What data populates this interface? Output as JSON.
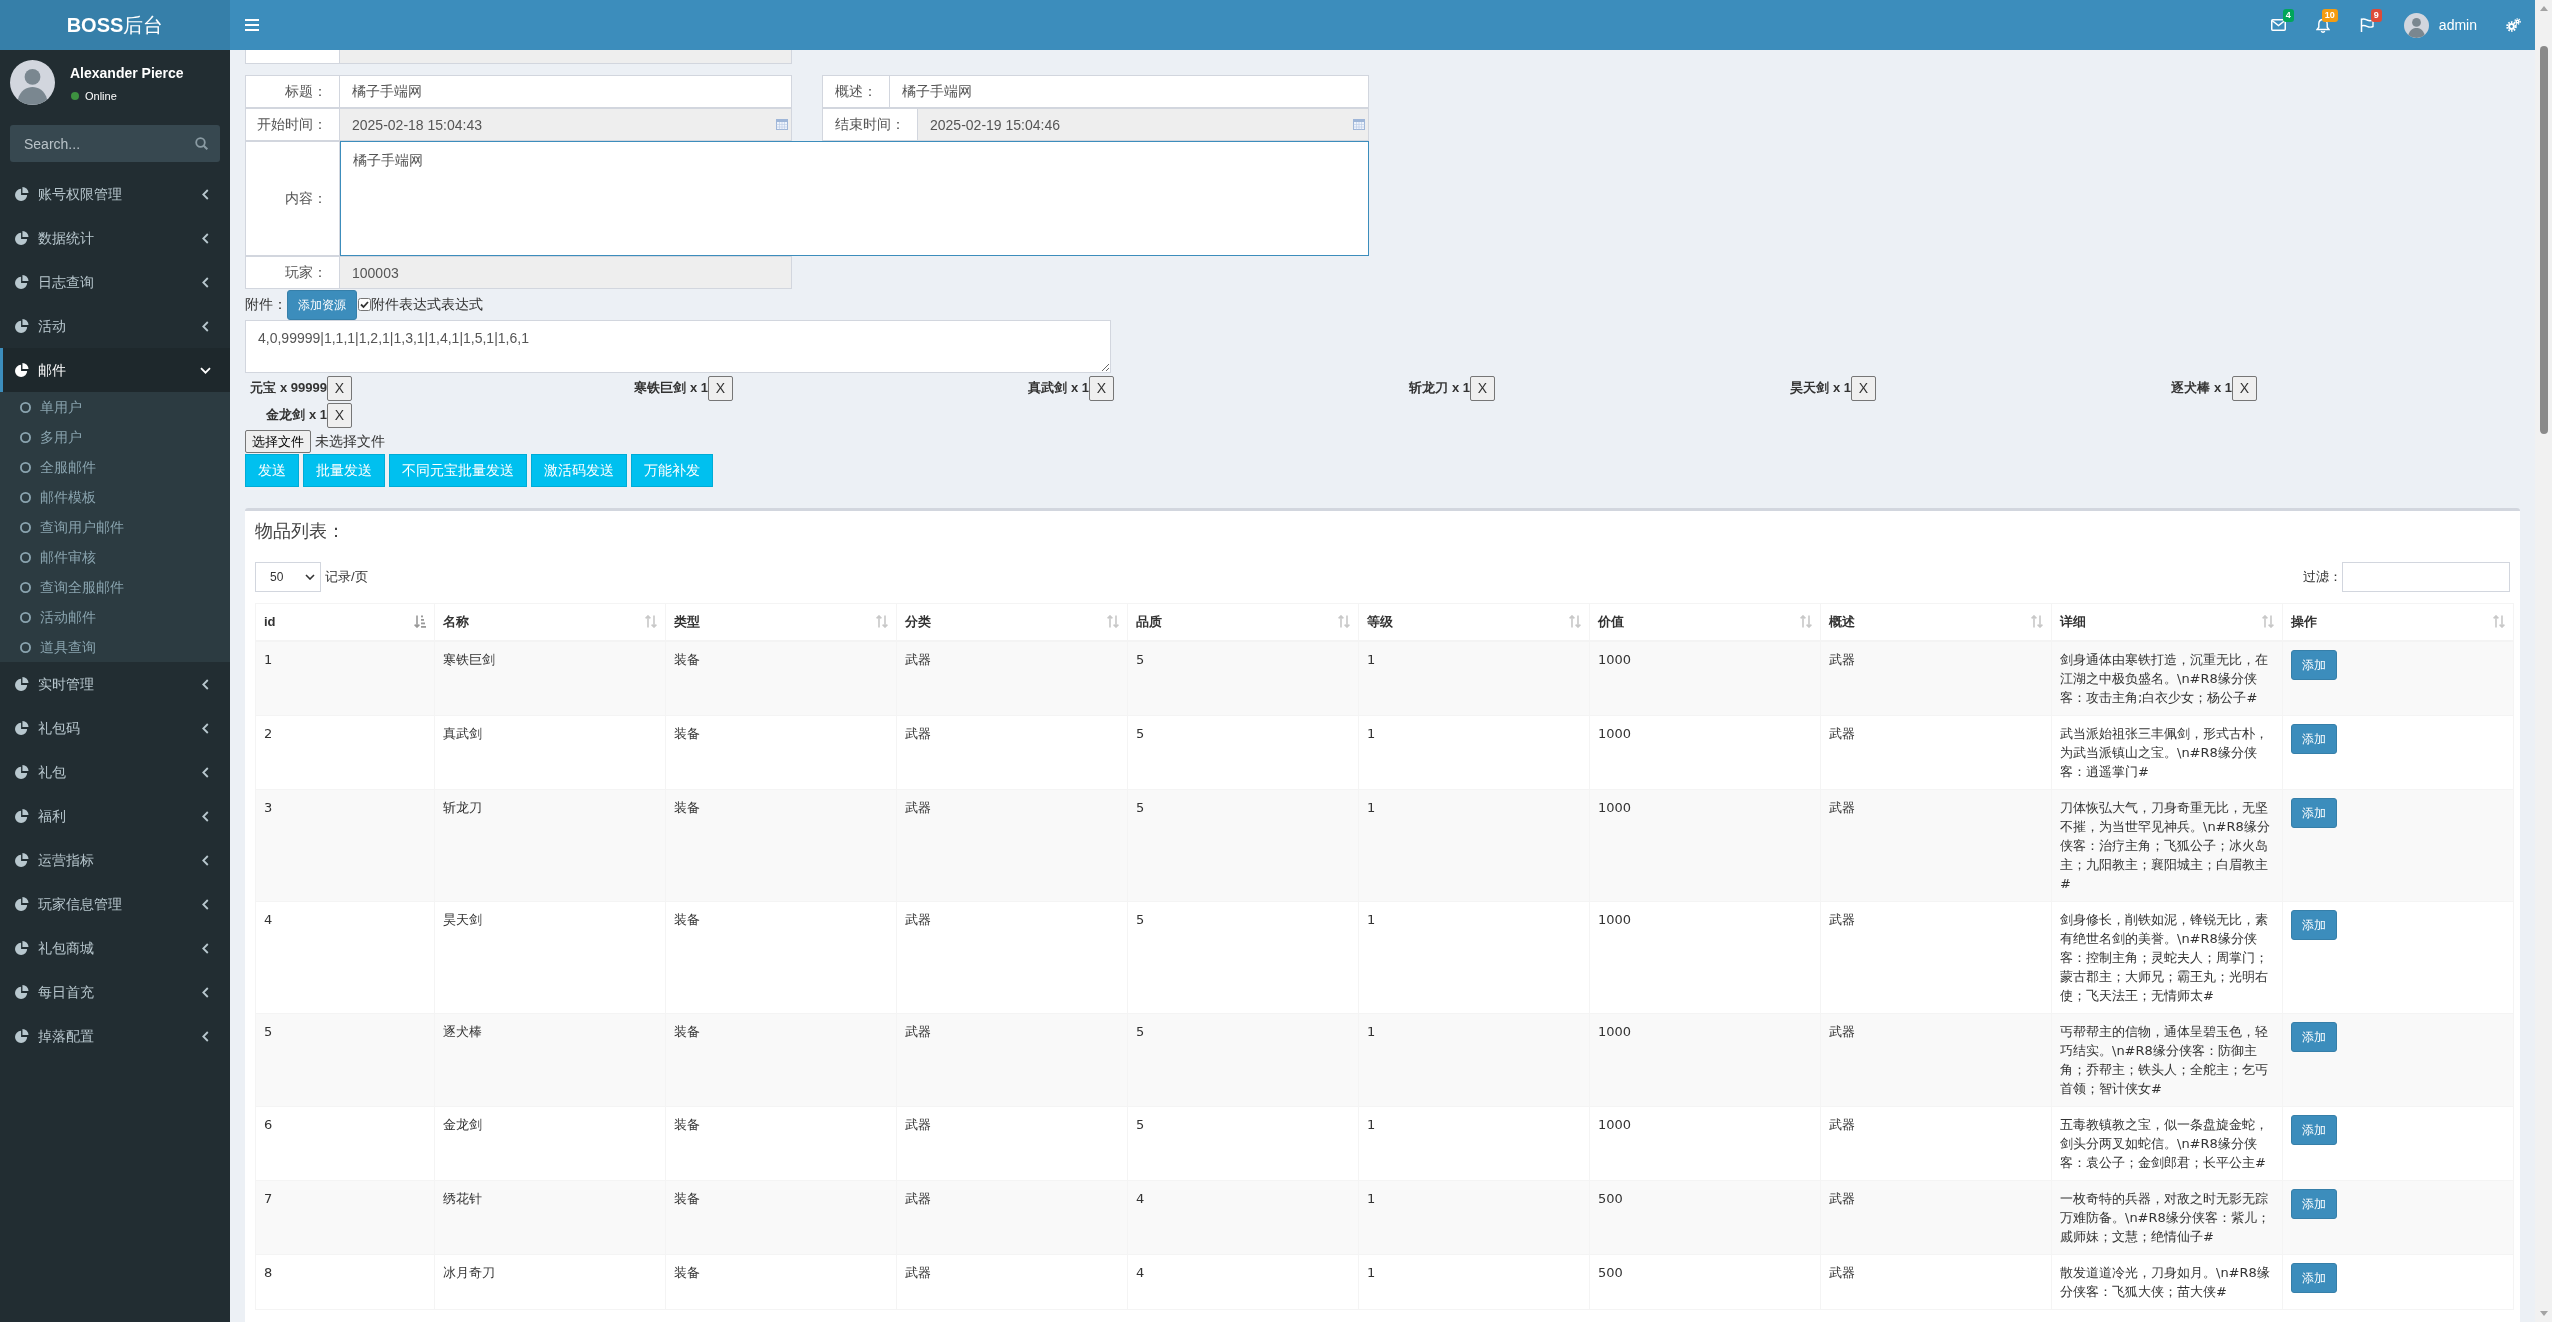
{
  "header": {
    "logo": "**BOSS**后台",
    "notifications": [
      {
        "kind": "mail",
        "count": "4",
        "color": "#00a65a"
      },
      {
        "kind": "bell",
        "count": "10",
        "color": "#f39c12"
      },
      {
        "kind": "flag",
        "count": "9",
        "color": "#dd4b39"
      }
    ],
    "user_name": "admin"
  },
  "sidebar": {
    "user": {
      "name": "Alexander Pierce",
      "status": "Online"
    },
    "search": {
      "placeholder": "Search..."
    },
    "menu": [
      {
        "label": "账号权限管理",
        "selected": false,
        "expanded": false
      },
      {
        "label": "数据统计",
        "selected": false,
        "expanded": false
      },
      {
        "label": "日志查询",
        "selected": false,
        "expanded": false
      },
      {
        "label": "活动",
        "selected": false,
        "expanded": false
      },
      {
        "label": "邮件",
        "selected": true,
        "expanded": true,
        "children": [
          {
            "label": "单用户",
            "selected": false
          },
          {
            "label": "多用户",
            "selected": false
          },
          {
            "label": "全服邮件",
            "selected": false
          },
          {
            "label": "邮件模板",
            "selected": false
          },
          {
            "label": "查询用户邮件",
            "selected": false
          },
          {
            "label": "邮件审核",
            "selected": false
          },
          {
            "label": "查询全服邮件",
            "selected": false
          },
          {
            "label": "活动邮件",
            "selected": false
          },
          {
            "label": "道具查询",
            "selected": false
          }
        ]
      },
      {
        "label": "实时管理",
        "selected": false,
        "expanded": false
      },
      {
        "label": "礼包码",
        "selected": false,
        "expanded": false
      },
      {
        "label": "礼包",
        "selected": false,
        "expanded": false
      },
      {
        "label": "福利",
        "selected": false,
        "expanded": false
      },
      {
        "label": "运营指标",
        "selected": false,
        "expanded": false
      },
      {
        "label": "玩家信息管理",
        "selected": false,
        "expanded": false
      },
      {
        "label": "礼包商城",
        "selected": false,
        "expanded": false
      },
      {
        "label": "每日首充",
        "selected": false,
        "expanded": false
      },
      {
        "label": "掉落配置",
        "selected": false,
        "expanded": false
      }
    ]
  },
  "form": {
    "title": {
      "label": "标题：",
      "value": "橘子手端网",
      "readonly": false
    },
    "summary": {
      "label": "概述：",
      "value": "橘子手端网",
      "readonly": false
    },
    "start_time": {
      "label": "开始时间：",
      "value": "2025-02-18 15:04:43",
      "readonly": true
    },
    "end_time": {
      "label": "结束时间：",
      "value": "2025-02-19 15:04:46",
      "readonly": true
    },
    "content": {
      "label": "内容：",
      "value": "橘子手端网",
      "focused": true
    },
    "player": {
      "label": "玩家：",
      "value": "100003",
      "readonly": true
    },
    "attachment": {
      "label": "附件：",
      "add_button": "添加资源",
      "expression_toggle": {
        "label": "附件表达式表达式",
        "checked": true
      },
      "expression": "4,0,99999|1,1,1|1,2,1|1,3,1|1,4,1|1,5,1|1,6,1",
      "items": [
        {
          "label": "元宝 x 99999",
          "remove_button": "X"
        },
        {
          "label": "寒铁巨剑 x 1",
          "remove_button": "X"
        },
        {
          "label": "真武剑 x 1",
          "remove_button": "X"
        },
        {
          "label": "斩龙刀 x 1",
          "remove_button": "X"
        },
        {
          "label": "昊天剑 x 1",
          "remove_button": "X"
        },
        {
          "label": "逐犬棒 x 1",
          "remove_button": "X"
        },
        {
          "label": "金龙剑 x 1",
          "remove_button": "X"
        }
      ]
    },
    "file_input": {
      "button": "选择文件",
      "status": "未选择文件"
    },
    "actions": [
      "发送",
      "批量发送",
      "不同元宝批量发送",
      "激活码发送",
      "万能补发"
    ]
  },
  "item_list": {
    "title": "物品列表：",
    "page_size": "50",
    "page_size_label": "记录/页",
    "filter_label": "过滤：",
    "columns": [
      {
        "label": "id",
        "sorted": true
      },
      {
        "label": "名称",
        "sorted": false
      },
      {
        "label": "类型",
        "sorted": false
      },
      {
        "label": "分类",
        "sorted": false
      },
      {
        "label": "品质",
        "sorted": false
      },
      {
        "label": "等级",
        "sorted": false
      },
      {
        "label": "价值",
        "sorted": false
      },
      {
        "label": "概述",
        "sorted": false
      },
      {
        "label": "详细",
        "sorted": false
      },
      {
        "label": "操作",
        "sorted": false
      }
    ],
    "rows": [
      {
        "cells": [
          "1",
          "寒铁巨剑",
          "装备",
          "武器",
          "5",
          "1",
          "1000",
          "武器",
          "剑身通体由寒铁打造，沉重无比，在江湖之中极负盛名。\\n#R8缘分侠客：攻击主角;白衣少女；杨公子#"
        ],
        "action": "添加"
      },
      {
        "cells": [
          "2",
          "真武剑",
          "装备",
          "武器",
          "5",
          "1",
          "1000",
          "武器",
          "武当派始祖张三丰佩剑，形式古朴，为武当派镇山之宝。\\n#R8缘分侠客：逍遥掌门#"
        ],
        "action": "添加"
      },
      {
        "cells": [
          "3",
          "斩龙刀",
          "装备",
          "武器",
          "5",
          "1",
          "1000",
          "武器",
          "刀体恢弘大气，刀身奇重无比，无坚不摧，为当世罕见神兵。\\n#R8缘分侠客：治疗主角；飞狐公子；冰火岛主；九阳教主；襄阳城主；白眉教主#"
        ],
        "action": "添加"
      },
      {
        "cells": [
          "4",
          "昊天剑",
          "装备",
          "武器",
          "5",
          "1",
          "1000",
          "武器",
          "剑身修长，削铁如泥，锋锐无比，素有绝世名剑的美誉。\\n#R8缘分侠客：控制主角；灵蛇夫人；周掌门；蒙古郡主；大师兄；霸王丸；光明右使；飞天法王；无情师太#"
        ],
        "action": "添加"
      },
      {
        "cells": [
          "5",
          "逐犬棒",
          "装备",
          "武器",
          "5",
          "1",
          "1000",
          "武器",
          "丐帮帮主的信物，通体呈碧玉色，轻巧结实。\\n#R8缘分侠客：防御主角；乔帮主；铁头人；全舵主；乞丐首领；智计侠女#"
        ],
        "action": "添加"
      },
      {
        "cells": [
          "6",
          "金龙剑",
          "装备",
          "武器",
          "5",
          "1",
          "1000",
          "武器",
          "五毒教镇教之宝，似一条盘旋金蛇，剑头分两叉如蛇信。\\n#R8缘分侠客：袁公子；金剑郎君；长平公主#"
        ],
        "action": "添加"
      },
      {
        "cells": [
          "7",
          "绣花针",
          "装备",
          "武器",
          "4",
          "1",
          "500",
          "武器",
          "一枚奇特的兵器，对敌之时无影无踪万难防备。\\n#R8缘分侠客：紫儿；戚师妹；文慧；绝情仙子#"
        ],
        "action": "添加"
      },
      {
        "cells": [
          "8",
          "冰月奇刀",
          "装备",
          "武器",
          "4",
          "1",
          "500",
          "武器",
          "散发道道冷光，刀身如月。\\n#R8缘分侠客：飞狐大侠；苗大侠#"
        ],
        "action": "添加"
      }
    ]
  }
}
